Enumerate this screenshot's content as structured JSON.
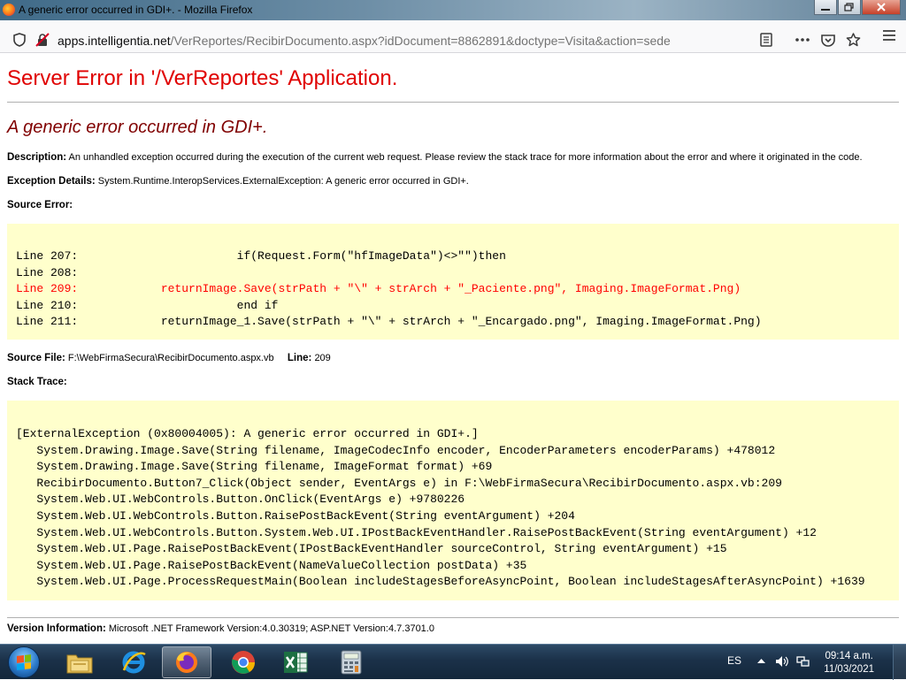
{
  "window": {
    "title": "A generic error occurred in GDI+. - Mozilla Firefox",
    "minimize": "▭",
    "restore": "⧉",
    "close": "✕"
  },
  "navbar": {
    "url_domain": "apps.intelligentia.net",
    "url_path": "/VerReportes/RecibirDocumento.aspx?idDocument=8862891&doctype=Visita&action=sede",
    "icons": [
      "shield-icon",
      "insecure-lock-icon",
      "reader-view-icon",
      "more-actions-icon",
      "pocket-icon",
      "bookmark-star-icon",
      "menu-icon"
    ]
  },
  "page": {
    "server_error_title": "Server Error in '/VerReportes' Application.",
    "error_message": "A generic error occurred in GDI+.",
    "description_label": "Description:",
    "description_text": "An unhandled exception occurred during the execution of the current web request. Please review the stack trace for more information about the error and where it originated in the code.",
    "exception_label": "Exception Details:",
    "exception_text": "System.Runtime.InteropServices.ExternalException: A generic error occurred in GDI+.",
    "source_error_label": "Source Error:",
    "source_lines": [
      "Line 207:                       if(Request.Form(\"hfImageData\")<>\"\")then",
      "Line 208:",
      "Line 209:            returnImage.Save(strPath + \"\\\" + strArch + \"_Paciente.png\", Imaging.ImageFormat.Png)",
      "Line 210:                       end if",
      "Line 211:            returnImage_1.Save(strPath + \"\\\" + strArch + \"_Encargado.png\", Imaging.ImageFormat.Png)"
    ],
    "source_file_label": "Source File:",
    "source_file_value": "F:\\WebFirmaSecura\\RecibirDocumento.aspx.vb",
    "line_label": "Line:",
    "line_value": "209",
    "stack_trace_label": "Stack Trace:",
    "stack_lines": [
      "[ExternalException (0x80004005): A generic error occurred in GDI+.]",
      "   System.Drawing.Image.Save(String filename, ImageCodecInfo encoder, EncoderParameters encoderParams) +478012",
      "   System.Drawing.Image.Save(String filename, ImageFormat format) +69",
      "   RecibirDocumento.Button7_Click(Object sender, EventArgs e) in F:\\WebFirmaSecura\\RecibirDocumento.aspx.vb:209",
      "   System.Web.UI.WebControls.Button.OnClick(EventArgs e) +9780226",
      "   System.Web.UI.WebControls.Button.RaisePostBackEvent(String eventArgument) +204",
      "   System.Web.UI.WebControls.Button.System.Web.UI.IPostBackEventHandler.RaisePostBackEvent(String eventArgument) +12",
      "   System.Web.UI.Page.RaisePostBackEvent(IPostBackEventHandler sourceControl, String eventArgument) +15",
      "   System.Web.UI.Page.RaisePostBackEvent(NameValueCollection postData) +35",
      "   System.Web.UI.Page.ProcessRequestMain(Boolean includeStagesBeforeAsyncPoint, Boolean includeStagesAfterAsyncPoint) +1639"
    ],
    "version_label": "Version Information:",
    "version_text": "Microsoft .NET Framework Version:4.0.30319; ASP.NET Version:4.7.3701.0"
  },
  "taskbar": {
    "apps": [
      "windows-explorer",
      "internet-explorer",
      "firefox",
      "chrome",
      "excel",
      "calculator"
    ],
    "language": "ES",
    "time": "09:14 a.m.",
    "date": "11/03/2021"
  },
  "colors": {
    "error_title": "#e00000",
    "error_message": "#800000",
    "code_background": "#ffffcc",
    "error_line": "#ff0000"
  }
}
